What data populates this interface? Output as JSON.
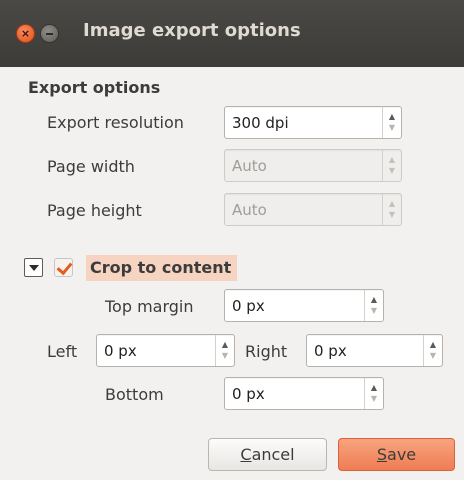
{
  "window": {
    "title": "Image export options",
    "close_glyph": "×"
  },
  "export_options": {
    "section_title": "Export options",
    "resolution": {
      "label": "Export resolution",
      "value": "300 dpi"
    },
    "page_width": {
      "label": "Page width",
      "value": "Auto"
    },
    "page_height": {
      "label": "Page height",
      "value": "Auto"
    }
  },
  "crop": {
    "label": "Crop to content",
    "checked": true,
    "top_margin": {
      "label": "Top margin",
      "value": "0 px"
    },
    "left": {
      "label": "Left",
      "value": "0 px"
    },
    "right": {
      "label": "Right",
      "value": "0 px"
    },
    "bottom": {
      "label": "Bottom",
      "value": "0 px"
    }
  },
  "buttons": {
    "cancel_first": "C",
    "cancel_rest": "ancel",
    "save_first": "S",
    "save_rest": "ave"
  },
  "colors": {
    "accent": "#ef7d53",
    "titlebar": "#3c3b37"
  }
}
